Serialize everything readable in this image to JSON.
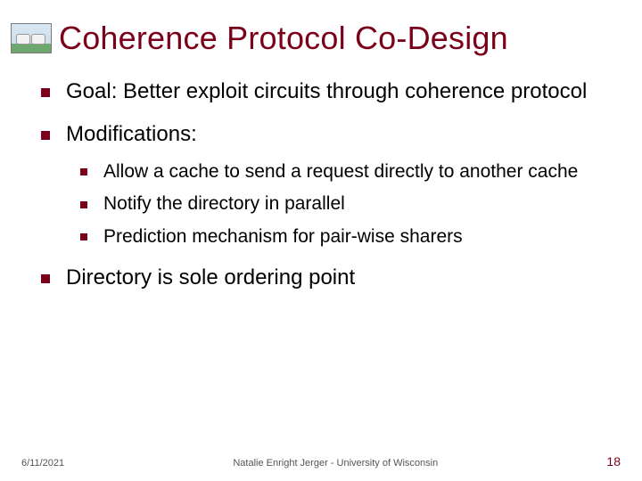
{
  "title": "Coherence Protocol Co-Design",
  "bullets": {
    "b0": "Goal: Better exploit circuits through coherence protocol",
    "b1": "Modifications:",
    "sub": {
      "s0": "Allow a cache to send a request directly to another cache",
      "s1": "Notify the directory in parallel",
      "s2": "Prediction mechanism for pair-wise sharers"
    },
    "b2": "Directory is sole ordering point"
  },
  "footer": {
    "date": "6/11/2021",
    "author": "Natalie Enright Jerger - University of Wisconsin",
    "page": "18"
  }
}
